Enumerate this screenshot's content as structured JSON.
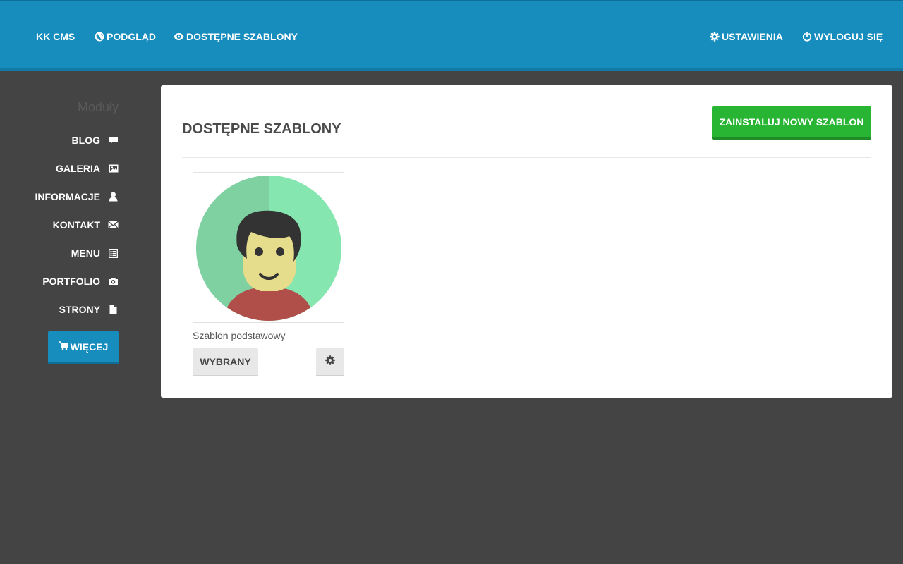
{
  "navbar": {
    "brand": "KK CMS",
    "preview": "PODGLĄD",
    "templates": "DOSTĘPNE SZABLONY",
    "settings": "USTAWIENIA",
    "logout": "WYLOGUJ SIĘ",
    "preview_icon": "globe-icon",
    "templates_icon": "eye-icon",
    "settings_icon": "gear-icon",
    "logout_icon": "power-icon",
    "background_color": "#178dbd"
  },
  "sidebar": {
    "title": "Moduły",
    "items": [
      {
        "label": "BLOG",
        "icon": "comment-icon"
      },
      {
        "label": "GALERIA",
        "icon": "picture-icon"
      },
      {
        "label": "INFORMACJE",
        "icon": "user-icon"
      },
      {
        "label": "KONTAKT",
        "icon": "envelope-icon"
      },
      {
        "label": "MENU",
        "icon": "list-icon"
      },
      {
        "label": "PORTFOLIO",
        "icon": "camera-icon"
      },
      {
        "label": "STRONY",
        "icon": "file-icon"
      }
    ],
    "more_button": "WIĘCEJ",
    "more_icon": "shopping-cart-icon"
  },
  "main": {
    "title": "DOSTĘPNE SZABLONY",
    "install_button": "ZAINSTALUJ NOWY SZABLON",
    "install_button_color": "#29b534",
    "templates": [
      {
        "name": "Szablon podstawowy",
        "status_button": "WYBRANY",
        "settings_icon": "gear-icon",
        "thumbnail": "avatar-illustration"
      }
    ]
  },
  "colors": {
    "page_background": "#444444",
    "accent": "#178dbd",
    "panel_background": "#ffffff"
  }
}
